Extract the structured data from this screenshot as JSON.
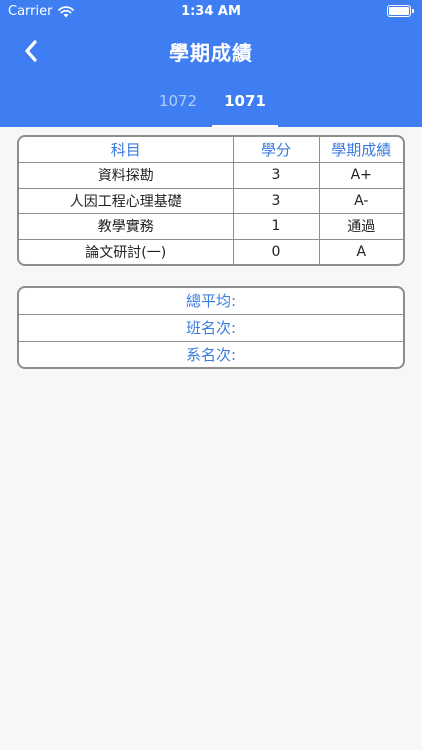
{
  "status": {
    "carrier": "Carrier",
    "time": "1:34 AM"
  },
  "header": {
    "title": "學期成績"
  },
  "tabs": [
    {
      "label": "1072"
    },
    {
      "label": "1071"
    }
  ],
  "grades": {
    "columns": [
      "科目",
      "學分",
      "學期成績"
    ],
    "rows": [
      {
        "subject": "資料探勘",
        "credit": "3",
        "grade": "A+"
      },
      {
        "subject": "人因工程心理基礎",
        "credit": "3",
        "grade": "A-"
      },
      {
        "subject": "教學實務",
        "credit": "1",
        "grade": "通過"
      },
      {
        "subject": "論文研討(一)",
        "credit": "0",
        "grade": "A"
      }
    ]
  },
  "summary": {
    "average_label": "總平均:",
    "class_rank_label": "班名次:",
    "dept_rank_label": "系名次:"
  },
  "colors": {
    "header": "#3f7ef2",
    "accent_text": "#3a7be0",
    "background": "#f7f7f7"
  },
  "icons": {
    "back": "chevron-left-icon",
    "wifi": "wifi-icon",
    "battery": "battery-icon"
  }
}
